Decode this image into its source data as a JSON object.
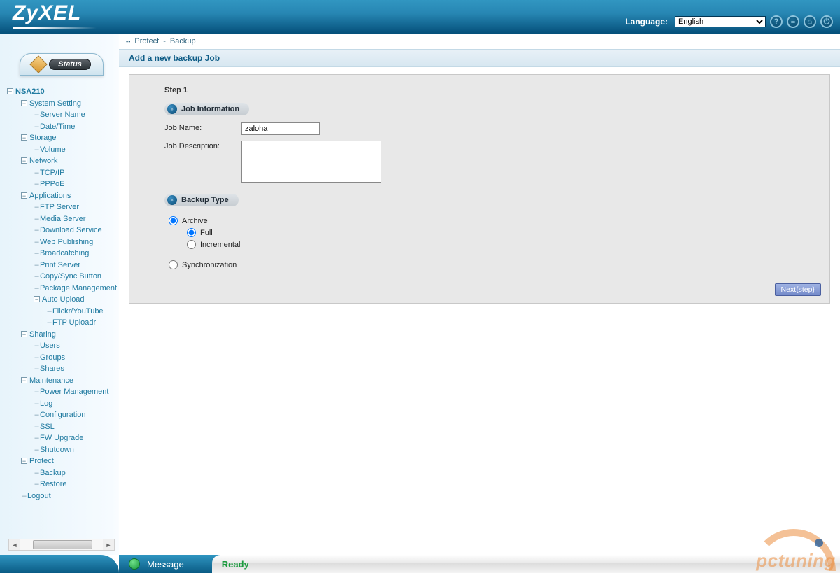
{
  "header": {
    "brand": "ZyXEL",
    "language_label": "Language:",
    "language_selected": "English",
    "icons": [
      "help",
      "log",
      "home",
      "logout"
    ]
  },
  "sidebar": {
    "status_label": "Status",
    "root": "NSA210",
    "groups": [
      {
        "label": "System Setting",
        "children": [
          "Server Name",
          "Date/Time"
        ]
      },
      {
        "label": "Storage",
        "children": [
          "Volume"
        ]
      },
      {
        "label": "Network",
        "children": [
          "TCP/IP",
          "PPPoE"
        ]
      },
      {
        "label": "Applications",
        "children": [
          "FTP Server",
          "Media Server",
          "Download Service",
          "Web Publishing",
          "Broadcatching",
          "Print Server",
          "Copy/Sync Button",
          "Package Management"
        ],
        "subgroup": {
          "label": "Auto Upload",
          "children": [
            "Flickr/YouTube",
            "FTP Uploadr"
          ]
        }
      },
      {
        "label": "Sharing",
        "children": [
          "Users",
          "Groups",
          "Shares"
        ]
      },
      {
        "label": "Maintenance",
        "children": [
          "Power Management",
          "Log",
          "Configuration",
          "SSL",
          "FW Upgrade",
          "Shutdown"
        ]
      },
      {
        "label": "Protect",
        "children": [
          "Backup",
          "Restore"
        ]
      },
      {
        "label": "Logout",
        "children": []
      }
    ]
  },
  "breadcrumbs": {
    "section": "Protect",
    "page": "Backup"
  },
  "page": {
    "title": "Add a new backup Job",
    "step": "Step 1",
    "sections": {
      "job_info": {
        "heading": "Job Information",
        "job_name_label": "Job Name:",
        "job_name_value": "zaloha",
        "job_desc_label": "Job Description:",
        "job_desc_value": ""
      },
      "backup_type": {
        "heading": "Backup Type",
        "archive_label": "Archive",
        "full_label": "Full",
        "incremental_label": "Incremental",
        "sync_label": "Synchronization",
        "selected_main": "archive",
        "selected_sub": "full"
      }
    },
    "next_button": "Next{step}"
  },
  "footer": {
    "message_label": "Message",
    "status": "Ready"
  },
  "watermark": "pctuning"
}
